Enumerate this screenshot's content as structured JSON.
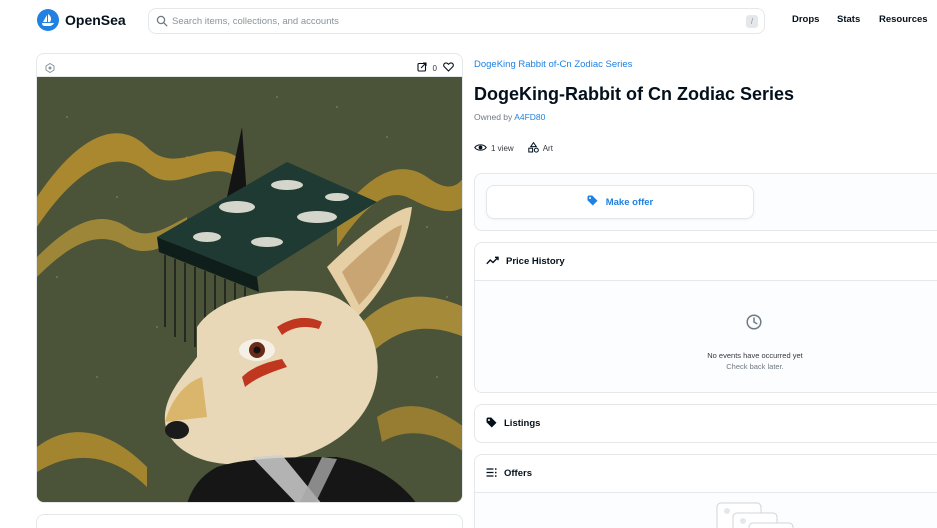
{
  "header": {
    "brand": "OpenSea",
    "search_placeholder": "Search items, collections, and accounts",
    "search_shortcut": "/",
    "nav": [
      "Drops",
      "Stats",
      "Resources"
    ]
  },
  "asset": {
    "favorites_count": "0",
    "collection_name": "DogeKing Rabbit of-Cn Zodiac Series",
    "title": "DogeKing-Rabbit of Cn Zodiac Series",
    "owned_by_label": "Owned by",
    "owner": "A4FD80",
    "views": "1 view",
    "category": "Art"
  },
  "actions": {
    "make_offer_label": "Make offer"
  },
  "panels": {
    "price_history": {
      "title": "Price History",
      "empty_title": "No events have occurred yet",
      "empty_subtitle": "Check back later."
    },
    "listings": {
      "title": "Listings"
    },
    "offers": {
      "title": "Offers"
    }
  },
  "colors": {
    "brand_blue": "#2081e2",
    "text_dark": "#04111d",
    "text_muted": "#707a83",
    "border": "#e5e8eb",
    "art_background": "#4a5337"
  },
  "icons": [
    "opensea-logo-icon",
    "search-icon",
    "chain-icon",
    "external-link-icon",
    "heart-icon",
    "eye-icon",
    "shapes-icon",
    "tag-icon",
    "trending-icon",
    "clock-icon",
    "list-icon"
  ]
}
